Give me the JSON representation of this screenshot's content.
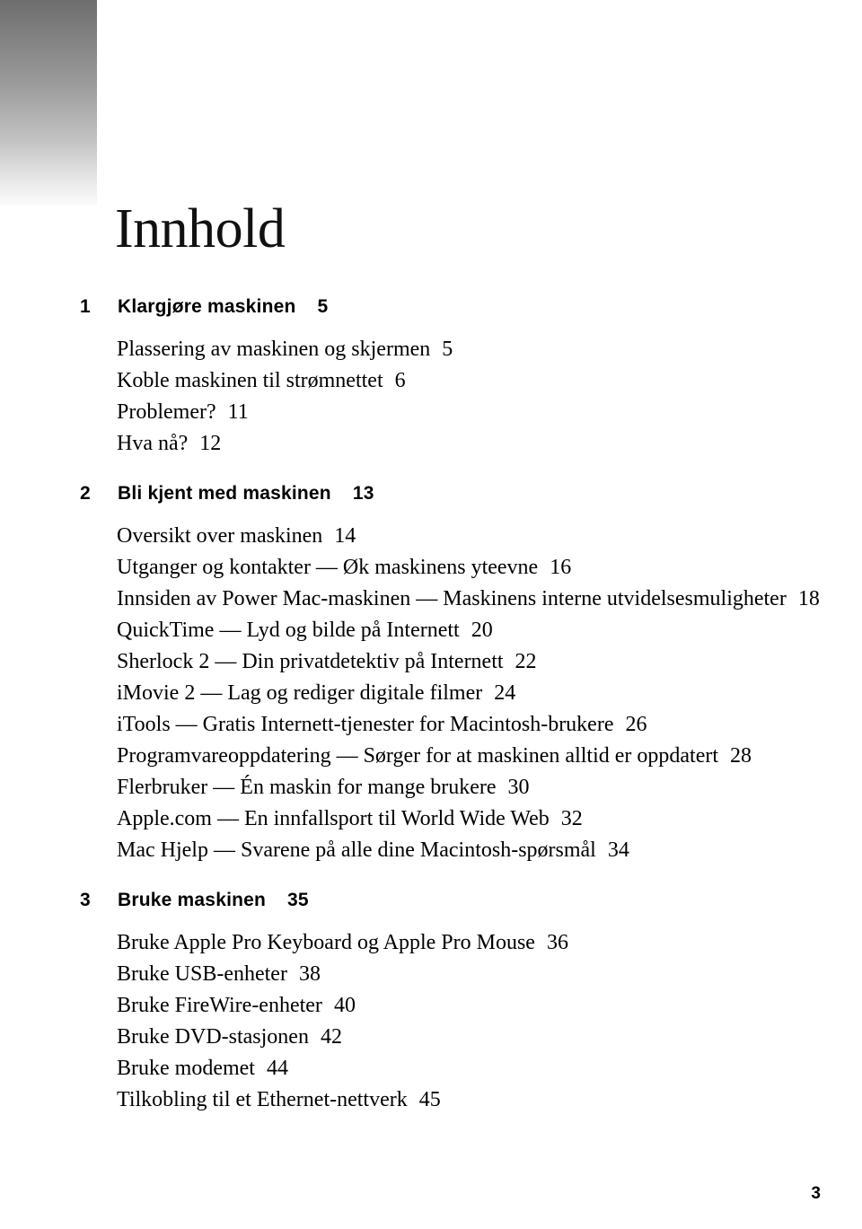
{
  "document": {
    "page_title": "Innhold",
    "folio": "3"
  },
  "toc": {
    "chapters": [
      {
        "number": "1",
        "title": "Klargjøre maskinen",
        "page": "5",
        "entries": [
          {
            "title": "Plassering av maskinen og skjermen",
            "page": "5"
          },
          {
            "title": "Koble maskinen til strømnettet",
            "page": "6"
          },
          {
            "title": "Problemer?",
            "page": "11"
          },
          {
            "title": "Hva nå?",
            "page": "12"
          }
        ]
      },
      {
        "number": "2",
        "title": "Bli kjent med maskinen",
        "page": "13",
        "entries": [
          {
            "title": "Oversikt over maskinen",
            "page": "14"
          },
          {
            "title": "Utganger og kontakter — Øk maskinens yteevne",
            "page": "16"
          },
          {
            "title": "Innsiden av Power Mac-maskinen — Maskinens interne utvidelsesmuligheter",
            "page": "18"
          },
          {
            "title": "QuickTime — Lyd og bilde på Internett",
            "page": "20"
          },
          {
            "title": "Sherlock 2 — Din privatdetektiv på Internett",
            "page": "22"
          },
          {
            "title": "iMovie 2 — Lag og rediger digitale filmer",
            "page": "24"
          },
          {
            "title": "iTools — Gratis Internett-tjenester for Macintosh-brukere",
            "page": "26"
          },
          {
            "title": "Programvareoppdatering — Sørger for at maskinen alltid er oppdatert",
            "page": "28"
          },
          {
            "title": "Flerbruker — Én maskin for mange brukere",
            "page": "30"
          },
          {
            "title": "Apple.com — En innfallsport til World Wide Web",
            "page": "32"
          },
          {
            "title": "Mac Hjelp — Svarene på alle dine Macintosh-spørsmål",
            "page": "34"
          }
        ]
      },
      {
        "number": "3",
        "title": "Bruke maskinen",
        "page": "35",
        "entries": [
          {
            "title": "Bruke Apple Pro Keyboard og Apple Pro Mouse",
            "page": "36"
          },
          {
            "title": "Bruke USB-enheter",
            "page": "38"
          },
          {
            "title": "Bruke FireWire-enheter",
            "page": "40"
          },
          {
            "title": "Bruke DVD-stasjonen",
            "page": "42"
          },
          {
            "title": "Bruke modemet",
            "page": "44"
          },
          {
            "title": "Tilkobling til et Ethernet-nettverk",
            "page": "45"
          }
        ]
      }
    ]
  },
  "decor": {
    "gradient_top_color": "#6e6e6e",
    "gradient_bottom_color": "#fbfbfb"
  }
}
